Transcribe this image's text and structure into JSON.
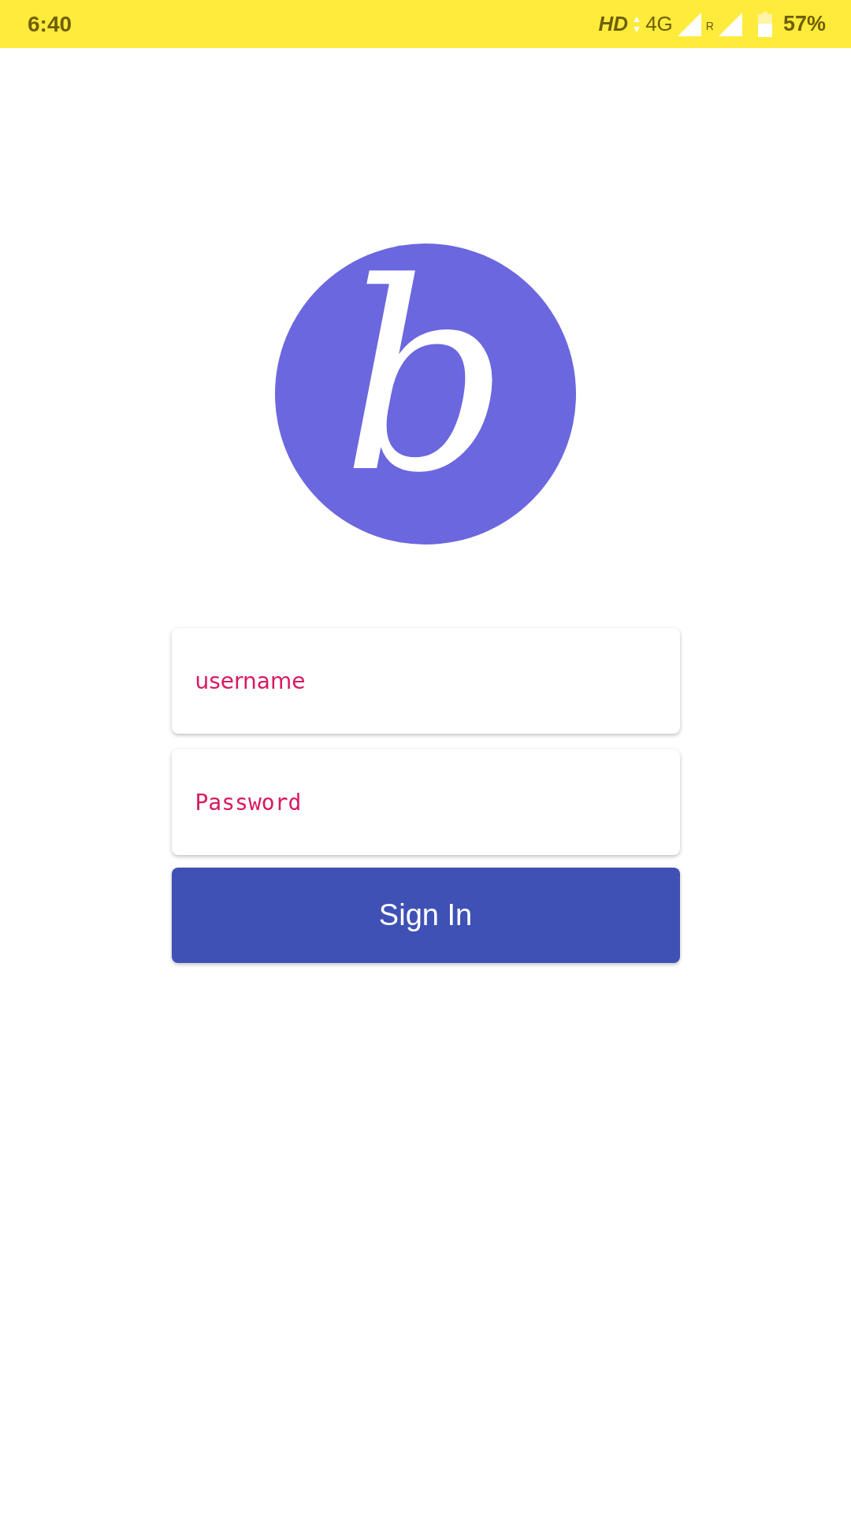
{
  "status_bar": {
    "time": "6:40",
    "hd": "HD",
    "network": "4G",
    "roaming": "R",
    "battery": "57%"
  },
  "logo": {
    "letter": "b"
  },
  "fields": [
    {
      "kind": "text",
      "placeholder": "username"
    },
    {
      "kind": "password",
      "placeholder": "Password"
    }
  ],
  "sign_in_button": "Sign In"
}
